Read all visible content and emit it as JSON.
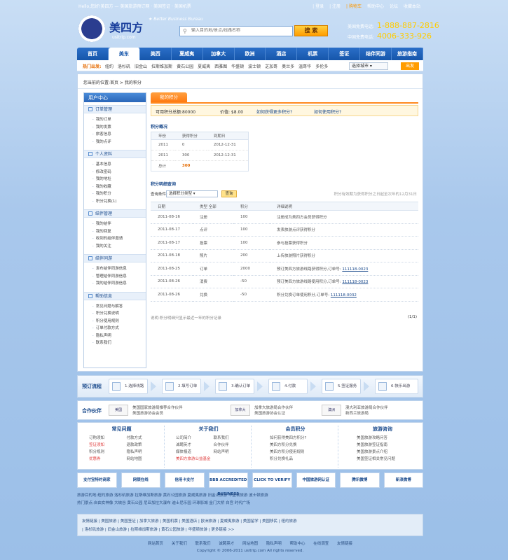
{
  "top": {
    "welcome": "Hello,您好!美四方 — 美国旅游预订网 · 美国签证 · 美国机票",
    "links": [
      "| 登录",
      "| 注册",
      "| 购物车",
      "帮助中心",
      "论坛",
      "收藏本站"
    ]
  },
  "header": {
    "logo_text": "美四方",
    "logo_url": "usitrip.com",
    "slogan": "★ Better Business Bureau",
    "search_placeholder": "输入目的地/景点/线路名称",
    "search_button": "搜 索",
    "hotline_label": "美国免费电话:",
    "hotline_us": "1-888-887-2816",
    "hotline_cn_label": "中国免费电话:",
    "hotline_cn": "4006-333-926"
  },
  "nav": [
    "首页",
    "美东",
    "美西",
    "夏威夷",
    "加拿大",
    "欧洲",
    "酒店",
    "机票",
    "签证",
    "结伴同游",
    "旅游指南"
  ],
  "nav_active": 1,
  "subnav": {
    "hot_label": "热门出发:",
    "cities": [
      "纽约",
      "洛杉矶",
      "旧金山",
      "拉斯维加斯",
      "黄石公园",
      "夏威夷",
      "西雅图",
      "华盛顿",
      "波士顿",
      "芝加哥",
      "奥兰多",
      "温哥华",
      "多伦多"
    ],
    "select_value": "选择城市 ▾",
    "go": "出发"
  },
  "breadcrumb": "您当前的位置:首页 > 我的积分",
  "sidebar": {
    "title": "用户中心",
    "sections": [
      {
        "title": "订单管理",
        "items": [
          "我的订单",
          "我的发票",
          "旅客信息",
          "我的点评"
        ]
      },
      {
        "title": "个人资料",
        "items": [
          "基本信息",
          "修改密码",
          "我的地址",
          "我的收藏",
          "我的积分",
          "积分兑换(1)"
        ]
      },
      {
        "title": "结伴管理",
        "items": [
          "我的结伴",
          "我的回复",
          "收到的结伴邀请",
          "我的关注"
        ]
      },
      {
        "title": "结伴同游",
        "items": [
          "发布结伴同游信息",
          "管理结伴同游信息",
          "我的结伴同游信息"
        ]
      },
      {
        "title": "帮助信息",
        "items": [
          "常见问题与解答",
          "积分兑换说明",
          "积分使用规则",
          "订单付款方式",
          "隐私声明",
          "联系我们"
        ]
      }
    ]
  },
  "tab": "我的积分",
  "summary": {
    "available": "可用积分总额:80000",
    "value": "价值: $8.00",
    "how_earn": "如何获得更多积分?",
    "how_use": "如何使用积分?"
  },
  "overview": {
    "heading": "积分概况",
    "columns": [
      "年份",
      "获得积分",
      "到期日"
    ],
    "rows": [
      [
        "2011",
        "0",
        "2012-12-31"
      ],
      [
        "2011",
        "300",
        "2012-12-31"
      ],
      [
        "总计",
        "300",
        ""
      ]
    ]
  },
  "detail": {
    "heading": "积分明细查询",
    "filter_label": "查询条件:",
    "filter_value": "选择积分类型",
    "query_button": "查询",
    "hint": "积分有效期为获得积分之日起至次年的12月31日",
    "columns": [
      "日期",
      "类型 全部",
      "积分",
      "详细说明"
    ],
    "rows": [
      [
        "2011-08-16",
        "注册",
        "100",
        "注册成为美四方会员获得积分",
        ""
      ],
      [
        "2011-08-17",
        "点评",
        "100",
        "发表旅游点评获得积分",
        ""
      ],
      [
        "2011-08-17",
        "投票",
        "100",
        "参与投票获得积分",
        ""
      ],
      [
        "2011-08-18",
        "照片",
        "200",
        "上传旅游照片获得积分",
        ""
      ],
      [
        "2011-08-25",
        "订单",
        "2000",
        "预订美四方旅游线路获得积分,订单号:",
        "111118-0023"
      ],
      [
        "2011-08-26",
        "消费",
        "-50",
        "预订美四方旅游线路使用积分,订单号:",
        "111118-0023"
      ],
      [
        "2011-08-26",
        "兑换",
        "-50",
        "积分兑换订单使用积分,订单号:",
        "111118-0032"
      ]
    ],
    "foot": "说明:积分明细只显示最近一年的积分记录",
    "pager": "(1/1)"
  },
  "process": {
    "label": "预订流程",
    "steps": [
      "1.选择线路",
      "2.填写订单",
      "3.确认订单",
      "4.付款",
      "5.签证服务",
      "6.快乐出游"
    ]
  },
  "partners": {
    "label": "合作伙伴",
    "logo1": "美国",
    "text1a": "美国国家旅游局推荐合作伙伴",
    "text1b": "美国旅游协会会员",
    "logo2": "加拿大",
    "text2a": "加拿大旅游局合作伙伴",
    "text2b": "美国旅游协会认证",
    "logo3": "澳洲",
    "text3a": "澳大利亚旅游局合作伙伴",
    "text3b": "新西兰旅游局"
  },
  "help": [
    {
      "title": "常见问题",
      "items": [
        "订购须知",
        "付款方式",
        "签证须知",
        "退款政策",
        "积分规则",
        "隐私声明",
        "优惠券",
        "网站地图"
      ],
      "red": [
        2,
        6
      ]
    },
    {
      "title": "关于我们",
      "items": [
        "公司简介",
        "联系我们",
        "诚聘英才",
        "合作伙伴",
        "媒体报道",
        "网站声明",
        "美四方旅游公益基金"
      ],
      "red": [
        6
      ]
    },
    {
      "title": "会员积分",
      "items": [
        "如何获得美四方积分?",
        "美四方积分兑换",
        "美四方积分使用规则",
        "积分兑换礼品"
      ],
      "red": []
    },
    {
      "title": "旅游咨询",
      "items": [
        "美国旅游攻略问答",
        "美国旅游签证指南",
        "美国旅游景点介绍",
        "美国签证相关常见问题"
      ],
      "red": []
    }
  ],
  "badges": [
    "支付宝特约商家",
    "网银在线",
    "信用卡支付",
    "BBB ACCREDITED BUSINESS",
    "CLICK TO VERIFY",
    "中国旅游网认证",
    "腾讯微博",
    "新浪微博"
  ],
  "links": [
    "旅游目的地:纽约旅游 洛杉矶旅游 拉斯维加斯旅游 黄石公园旅游 夏威夷旅游 旧金山旅游 华盛顿旅游 波士顿旅游",
    "热门景点:自由女神像 大峡谷 黄石公园 尼亚加拉大瀑布 迪士尼乐园 环球影城 金门大桥 白宫 时代广场"
  ],
  "friend_links": [
    "友情链接 | 美国旅游 | 美国签证 | 加拿大旅游 | 美国机票 | 美国酒店 | 欧洲旅游 | 夏威夷旅游 | 美国留学 | 美国移民 | 纽约旅游",
    "| 洛杉矶旅游 | 旧金山旅游 | 拉斯维加斯旅游 | 黄石公园旅游 | 华盛顿旅游 | 更多链接 >>"
  ],
  "bottom_nav": [
    "网站首页",
    "关于我们",
    "联系我们",
    "诚聘英才",
    "网站地图",
    "隐私声明",
    "帮助中心",
    "在线调查",
    "友情链接"
  ],
  "copyright": "Copyright © 2006-2011 usitrip.com All rights reserved."
}
